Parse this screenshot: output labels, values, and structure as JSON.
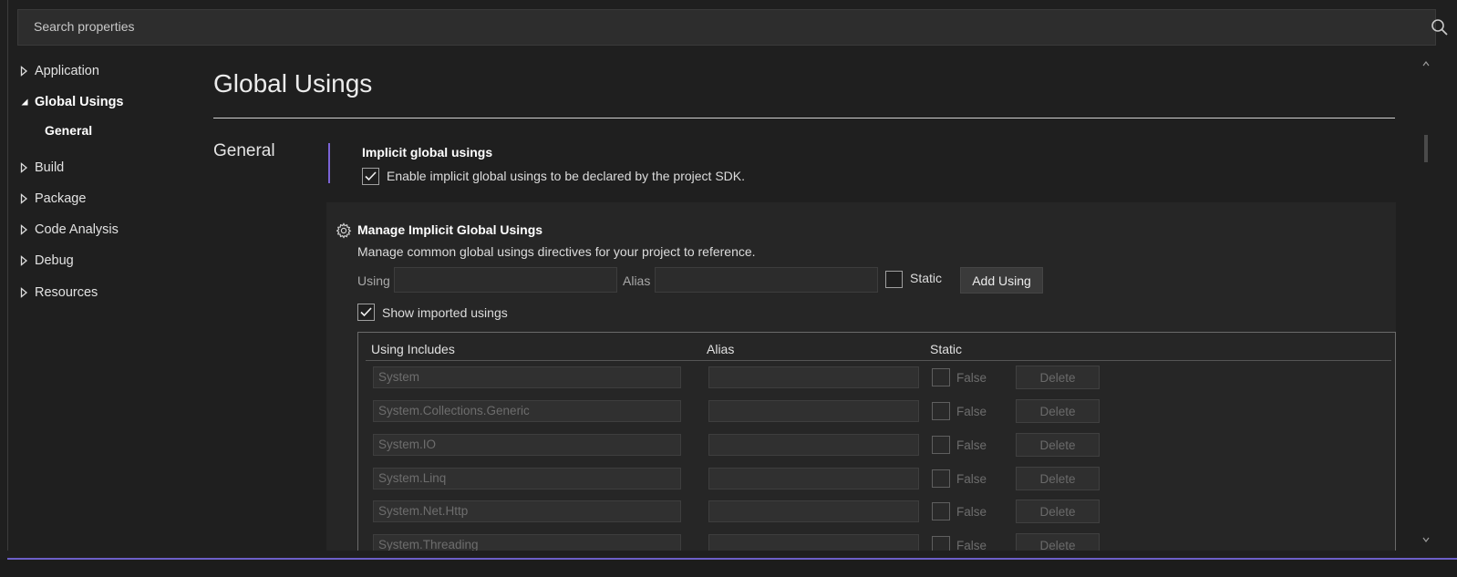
{
  "search": {
    "placeholder": "Search properties",
    "icon": "search-icon"
  },
  "sidebar": {
    "items": [
      {
        "label": "Application",
        "expanded": false
      },
      {
        "label": "Global Usings",
        "expanded": true,
        "selected": true
      },
      {
        "label": "Build",
        "expanded": false
      },
      {
        "label": "Package",
        "expanded": false
      },
      {
        "label": "Code Analysis",
        "expanded": false
      },
      {
        "label": "Debug",
        "expanded": false
      },
      {
        "label": "Resources",
        "expanded": false
      }
    ],
    "sub_item": "General"
  },
  "main": {
    "title": "Global Usings",
    "section": "General",
    "implicit": {
      "heading": "Implicit global usings",
      "checkbox_label": "Enable implicit global usings to be declared by the project SDK.",
      "checked": true
    },
    "manage": {
      "heading": "Manage Implicit Global Usings",
      "description": "Manage common global usings directives for your project to reference.",
      "using_label": "Using",
      "alias_label": "Alias",
      "static_label": "Static",
      "add_button": "Add Using",
      "show_imported_label": "Show imported usings",
      "show_imported_checked": true
    },
    "table": {
      "columns": [
        "Using Includes",
        "Alias",
        "Static"
      ],
      "rows": [
        {
          "using": "System",
          "alias": "",
          "static": "False",
          "action": "Delete"
        },
        {
          "using": "System.Collections.Generic",
          "alias": "",
          "static": "False",
          "action": "Delete"
        },
        {
          "using": "System.IO",
          "alias": "",
          "static": "False",
          "action": "Delete"
        },
        {
          "using": "System.Linq",
          "alias": "",
          "static": "False",
          "action": "Delete"
        },
        {
          "using": "System.Net.Http",
          "alias": "",
          "static": "False",
          "action": "Delete"
        },
        {
          "using": "System.Threading",
          "alias": "",
          "static": "False",
          "action": "Delete"
        }
      ]
    }
  },
  "colors": {
    "accent": "#7b64d6",
    "background": "#1f1f1f",
    "panel": "#262626"
  }
}
